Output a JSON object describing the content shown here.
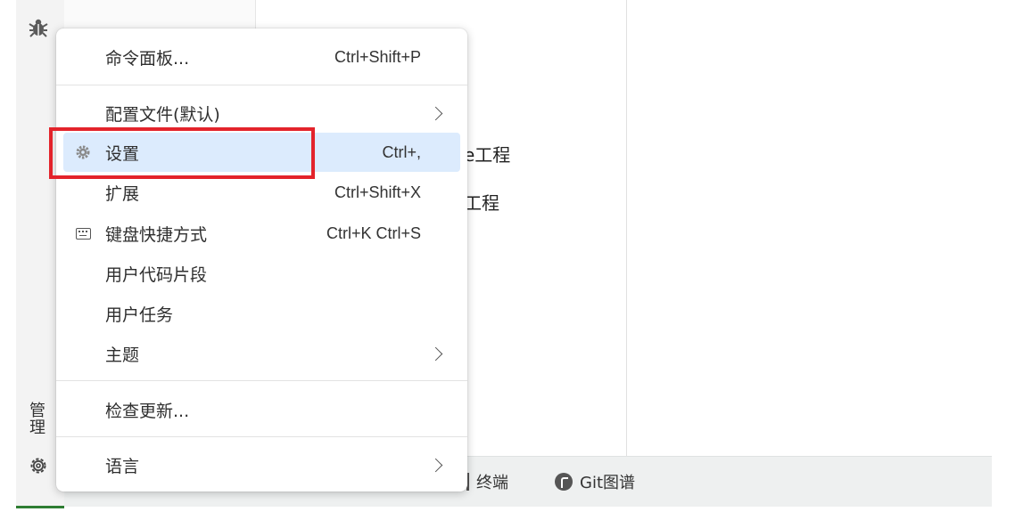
{
  "menu": {
    "items": [
      {
        "label": "命令面板...",
        "shortcut": "Ctrl+Shift+P"
      },
      {
        "label": "配置文件(默认)",
        "shortcut": ""
      },
      {
        "label": "设置",
        "shortcut": "Ctrl+,"
      },
      {
        "label": "扩展",
        "shortcut": "Ctrl+Shift+X"
      },
      {
        "label": "键盘快捷方式",
        "shortcut": "Ctrl+K Ctrl+S"
      },
      {
        "label": "用户代码片段",
        "shortcut": ""
      },
      {
        "label": "用户任务",
        "shortcut": ""
      },
      {
        "label": "主题",
        "shortcut": ""
      },
      {
        "label": "检查更新...",
        "shortcut": ""
      },
      {
        "label": "语言",
        "shortcut": ""
      }
    ]
  },
  "activity_bar": {
    "manage_label": "管理"
  },
  "background": {
    "text1": "e工程",
    "text2": "工程"
  },
  "panel": {
    "terminal_label": "终端",
    "git_graph_label": "Git图谱"
  },
  "colors": {
    "highlight_border": "#e3232b",
    "active_item_bg": "#dcebfd"
  }
}
